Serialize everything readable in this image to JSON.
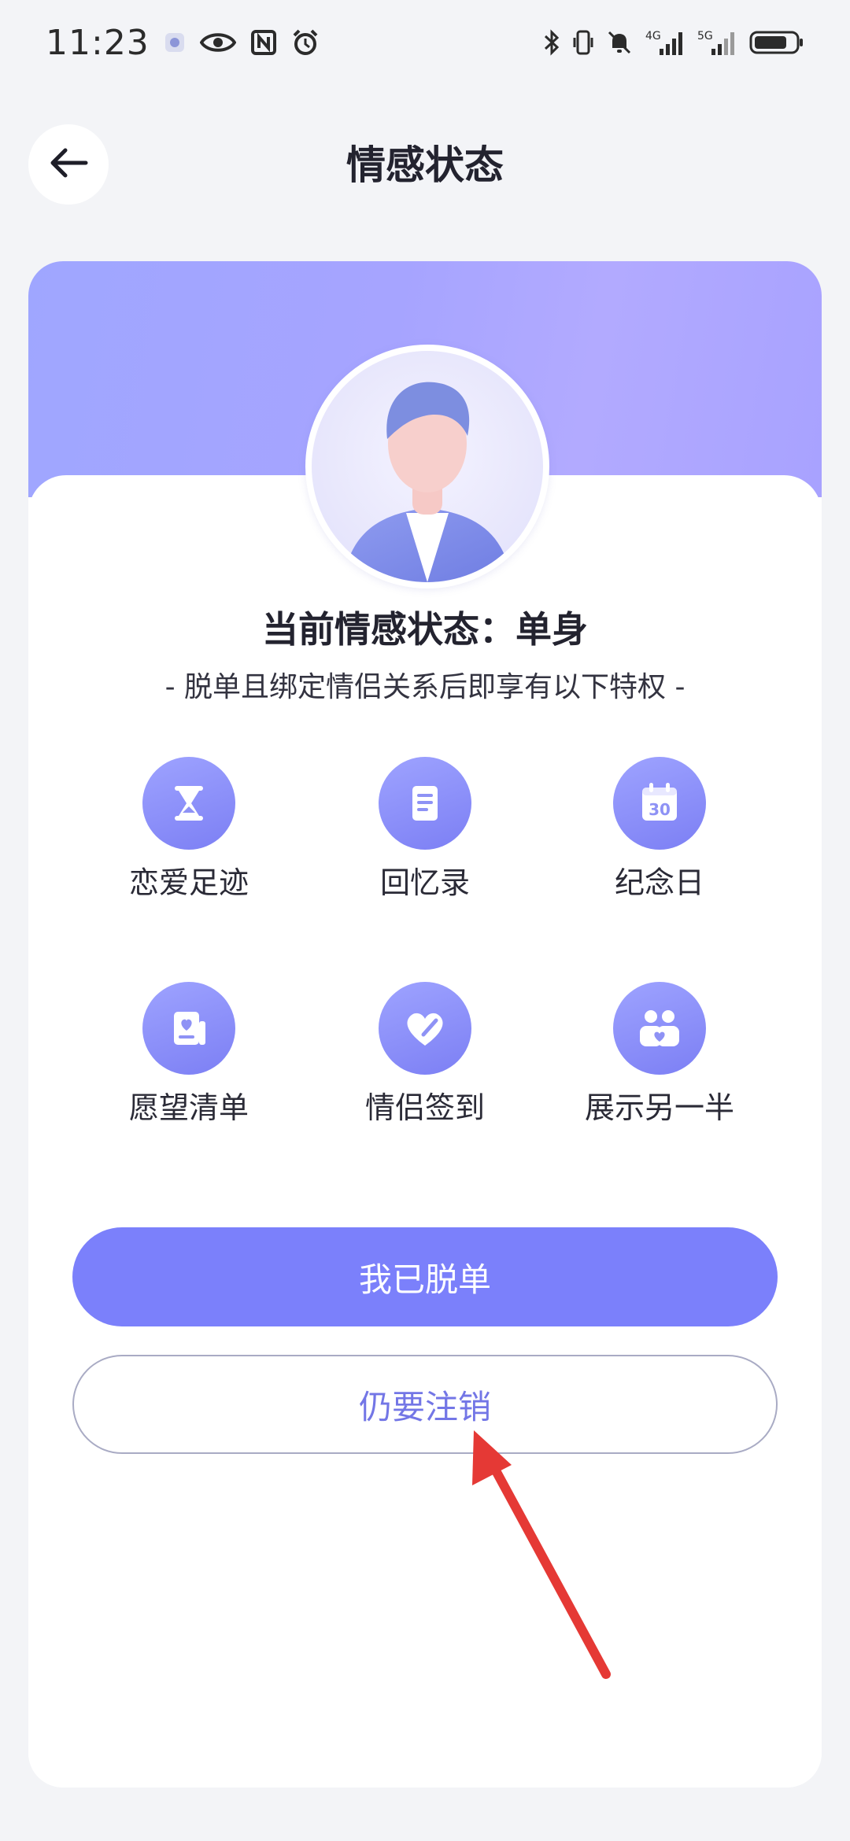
{
  "status_bar": {
    "time": "11:23",
    "left_icons": [
      "app-notification-icon",
      "eye-icon",
      "nfc-icon",
      "alarm-icon"
    ],
    "right_icons": [
      "bluetooth-icon",
      "vibrate-icon",
      "mute-icon",
      "signal-4g-icon",
      "signal-5g-icon",
      "battery-icon"
    ],
    "signal_4g_label": "4G",
    "signal_5g_label": "5G"
  },
  "header": {
    "title": "情感状态",
    "back_icon": "arrow-left-icon"
  },
  "card": {
    "status_title": "当前情感状态：单身",
    "subtitle": "- 脱单且绑定情侣关系后即享有以下特权 -",
    "privileges": [
      {
        "label": "恋爱足迹",
        "icon": "hourglass-icon"
      },
      {
        "label": "回忆录",
        "icon": "notebook-icon"
      },
      {
        "label": "纪念日",
        "icon": "calendar-icon",
        "icon_text": "30"
      },
      {
        "label": "愿望清单",
        "icon": "wishlist-icon"
      },
      {
        "label": "情侣签到",
        "icon": "heart-checkin-icon"
      },
      {
        "label": "展示另一半",
        "icon": "couple-icon"
      }
    ],
    "primary_button": "我已脱单",
    "secondary_button": "仍要注销"
  },
  "colors": {
    "accent": "#7b80fb",
    "secondary_text": "#7376e6",
    "banner_start": "#9fa6ff",
    "banner_end": "#a8a2ff",
    "annotation_arrow": "#e53935"
  }
}
